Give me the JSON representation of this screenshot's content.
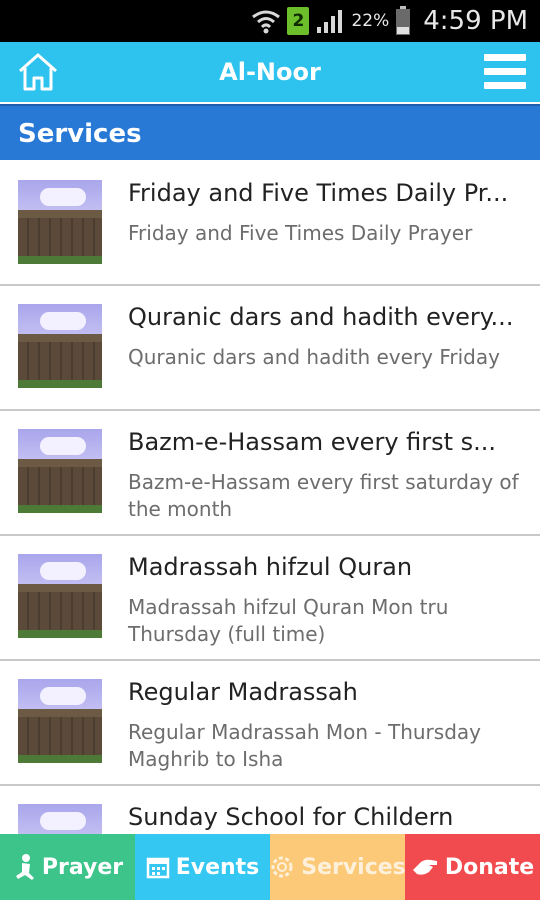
{
  "status_bar": {
    "sim_slot": "2",
    "battery_percent": "22%",
    "time": "4:59 PM"
  },
  "app_bar": {
    "title": "Al-Noor"
  },
  "section": {
    "title": "Services"
  },
  "services": [
    {
      "title": "Friday and Five Times Daily Pr...",
      "subtitle": "Friday and Five Times Daily Prayer"
    },
    {
      "title": "Quranic dars and hadith every...",
      "subtitle": "Quranic dars and hadith every Friday"
    },
    {
      "title": "Bazm-e-Hassam every first s...",
      "subtitle": "Bazm-e-Hassam every first saturday of the month"
    },
    {
      "title": "Madrassah hifzul Quran",
      "subtitle": "Madrassah hifzul Quran Mon tru Thursday (full time)"
    },
    {
      "title": "Regular Madrassah",
      "subtitle": "Regular Madrassah Mon - Thursday Maghrib to Isha"
    },
    {
      "title": "Sunday School for Childern",
      "subtitle": ""
    }
  ],
  "bottom_nav": {
    "tabs": [
      {
        "label": "Prayer",
        "icon": "praying-person-icon",
        "color": "#3cc48a"
      },
      {
        "label": "Events",
        "icon": "calendar-icon",
        "color": "#33c7f1"
      },
      {
        "label": "Services",
        "icon": "gear-icon",
        "color": "#fbc978"
      },
      {
        "label": "Donate",
        "icon": "hand-icon",
        "color": "#f14b4f"
      }
    ]
  },
  "colors": {
    "app_bar": "#2ec3ee",
    "section_header": "#2879d6"
  }
}
